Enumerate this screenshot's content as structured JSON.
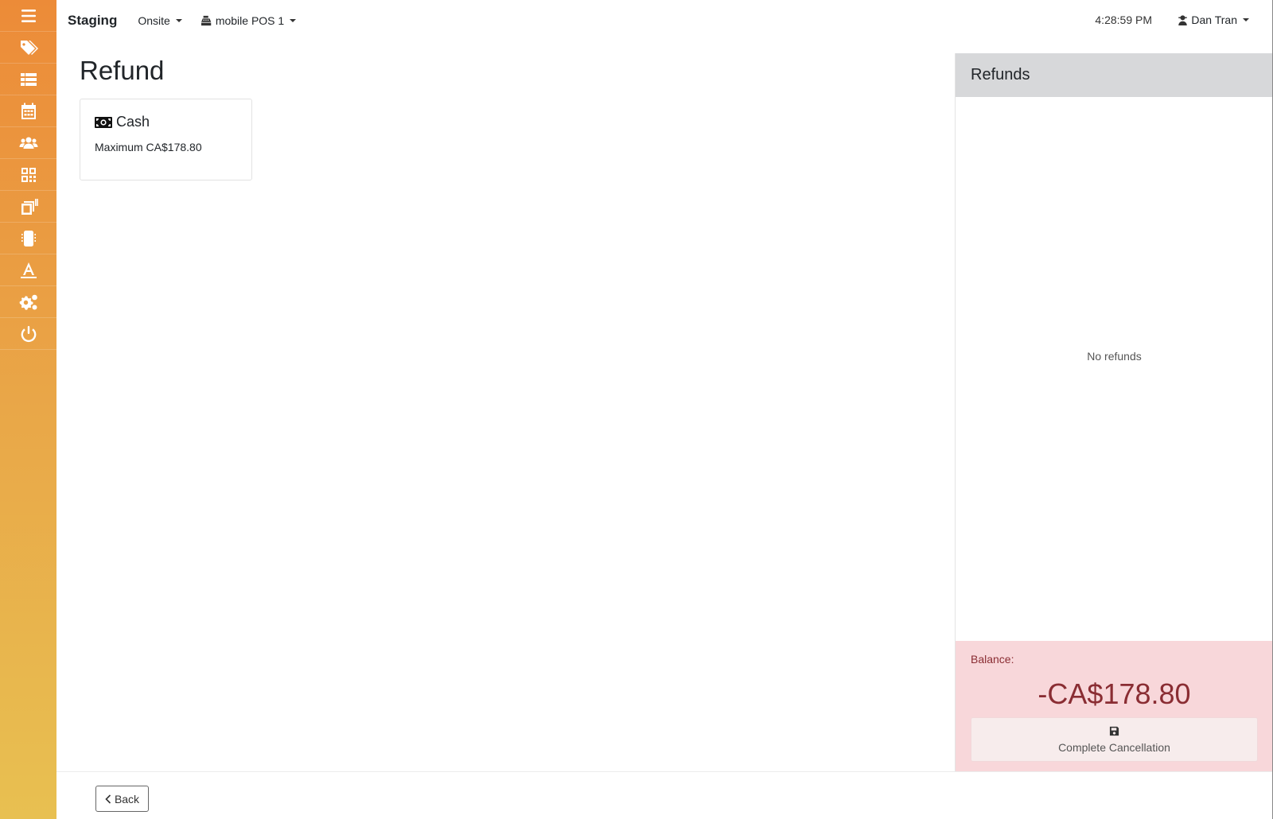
{
  "sidebar": {
    "items": [
      {
        "icon": "menu-icon"
      },
      {
        "icon": "tags-icon"
      },
      {
        "icon": "list-icon"
      },
      {
        "icon": "calendar-icon"
      },
      {
        "icon": "users-icon"
      },
      {
        "icon": "qrcode-icon"
      },
      {
        "icon": "print-icon"
      },
      {
        "icon": "device-icon"
      },
      {
        "icon": "signature-icon"
      },
      {
        "icon": "settings-icon"
      },
      {
        "icon": "power-icon"
      }
    ],
    "gradient": [
      "#ec8b38",
      "#e8c051"
    ]
  },
  "topbar": {
    "brand": "Staging",
    "location": "Onsite",
    "register": "mobile POS 1",
    "time": "4:28:59 PM",
    "user": "Dan Tran"
  },
  "main": {
    "title": "Refund",
    "methods": [
      {
        "name": "Cash",
        "icon": "money-bill-icon",
        "subtitle": "Maximum CA$178.80"
      }
    ]
  },
  "refunds_panel": {
    "title": "Refunds",
    "empty_text": "No refunds",
    "balance_label": "Balance:",
    "balance_amount": "-CA$178.80",
    "complete_label": "Complete Cancellation",
    "colors": {
      "alert_bg": "#f8d7da",
      "alert_text": "#8a2d33"
    }
  },
  "footer": {
    "back_label": "Back"
  }
}
